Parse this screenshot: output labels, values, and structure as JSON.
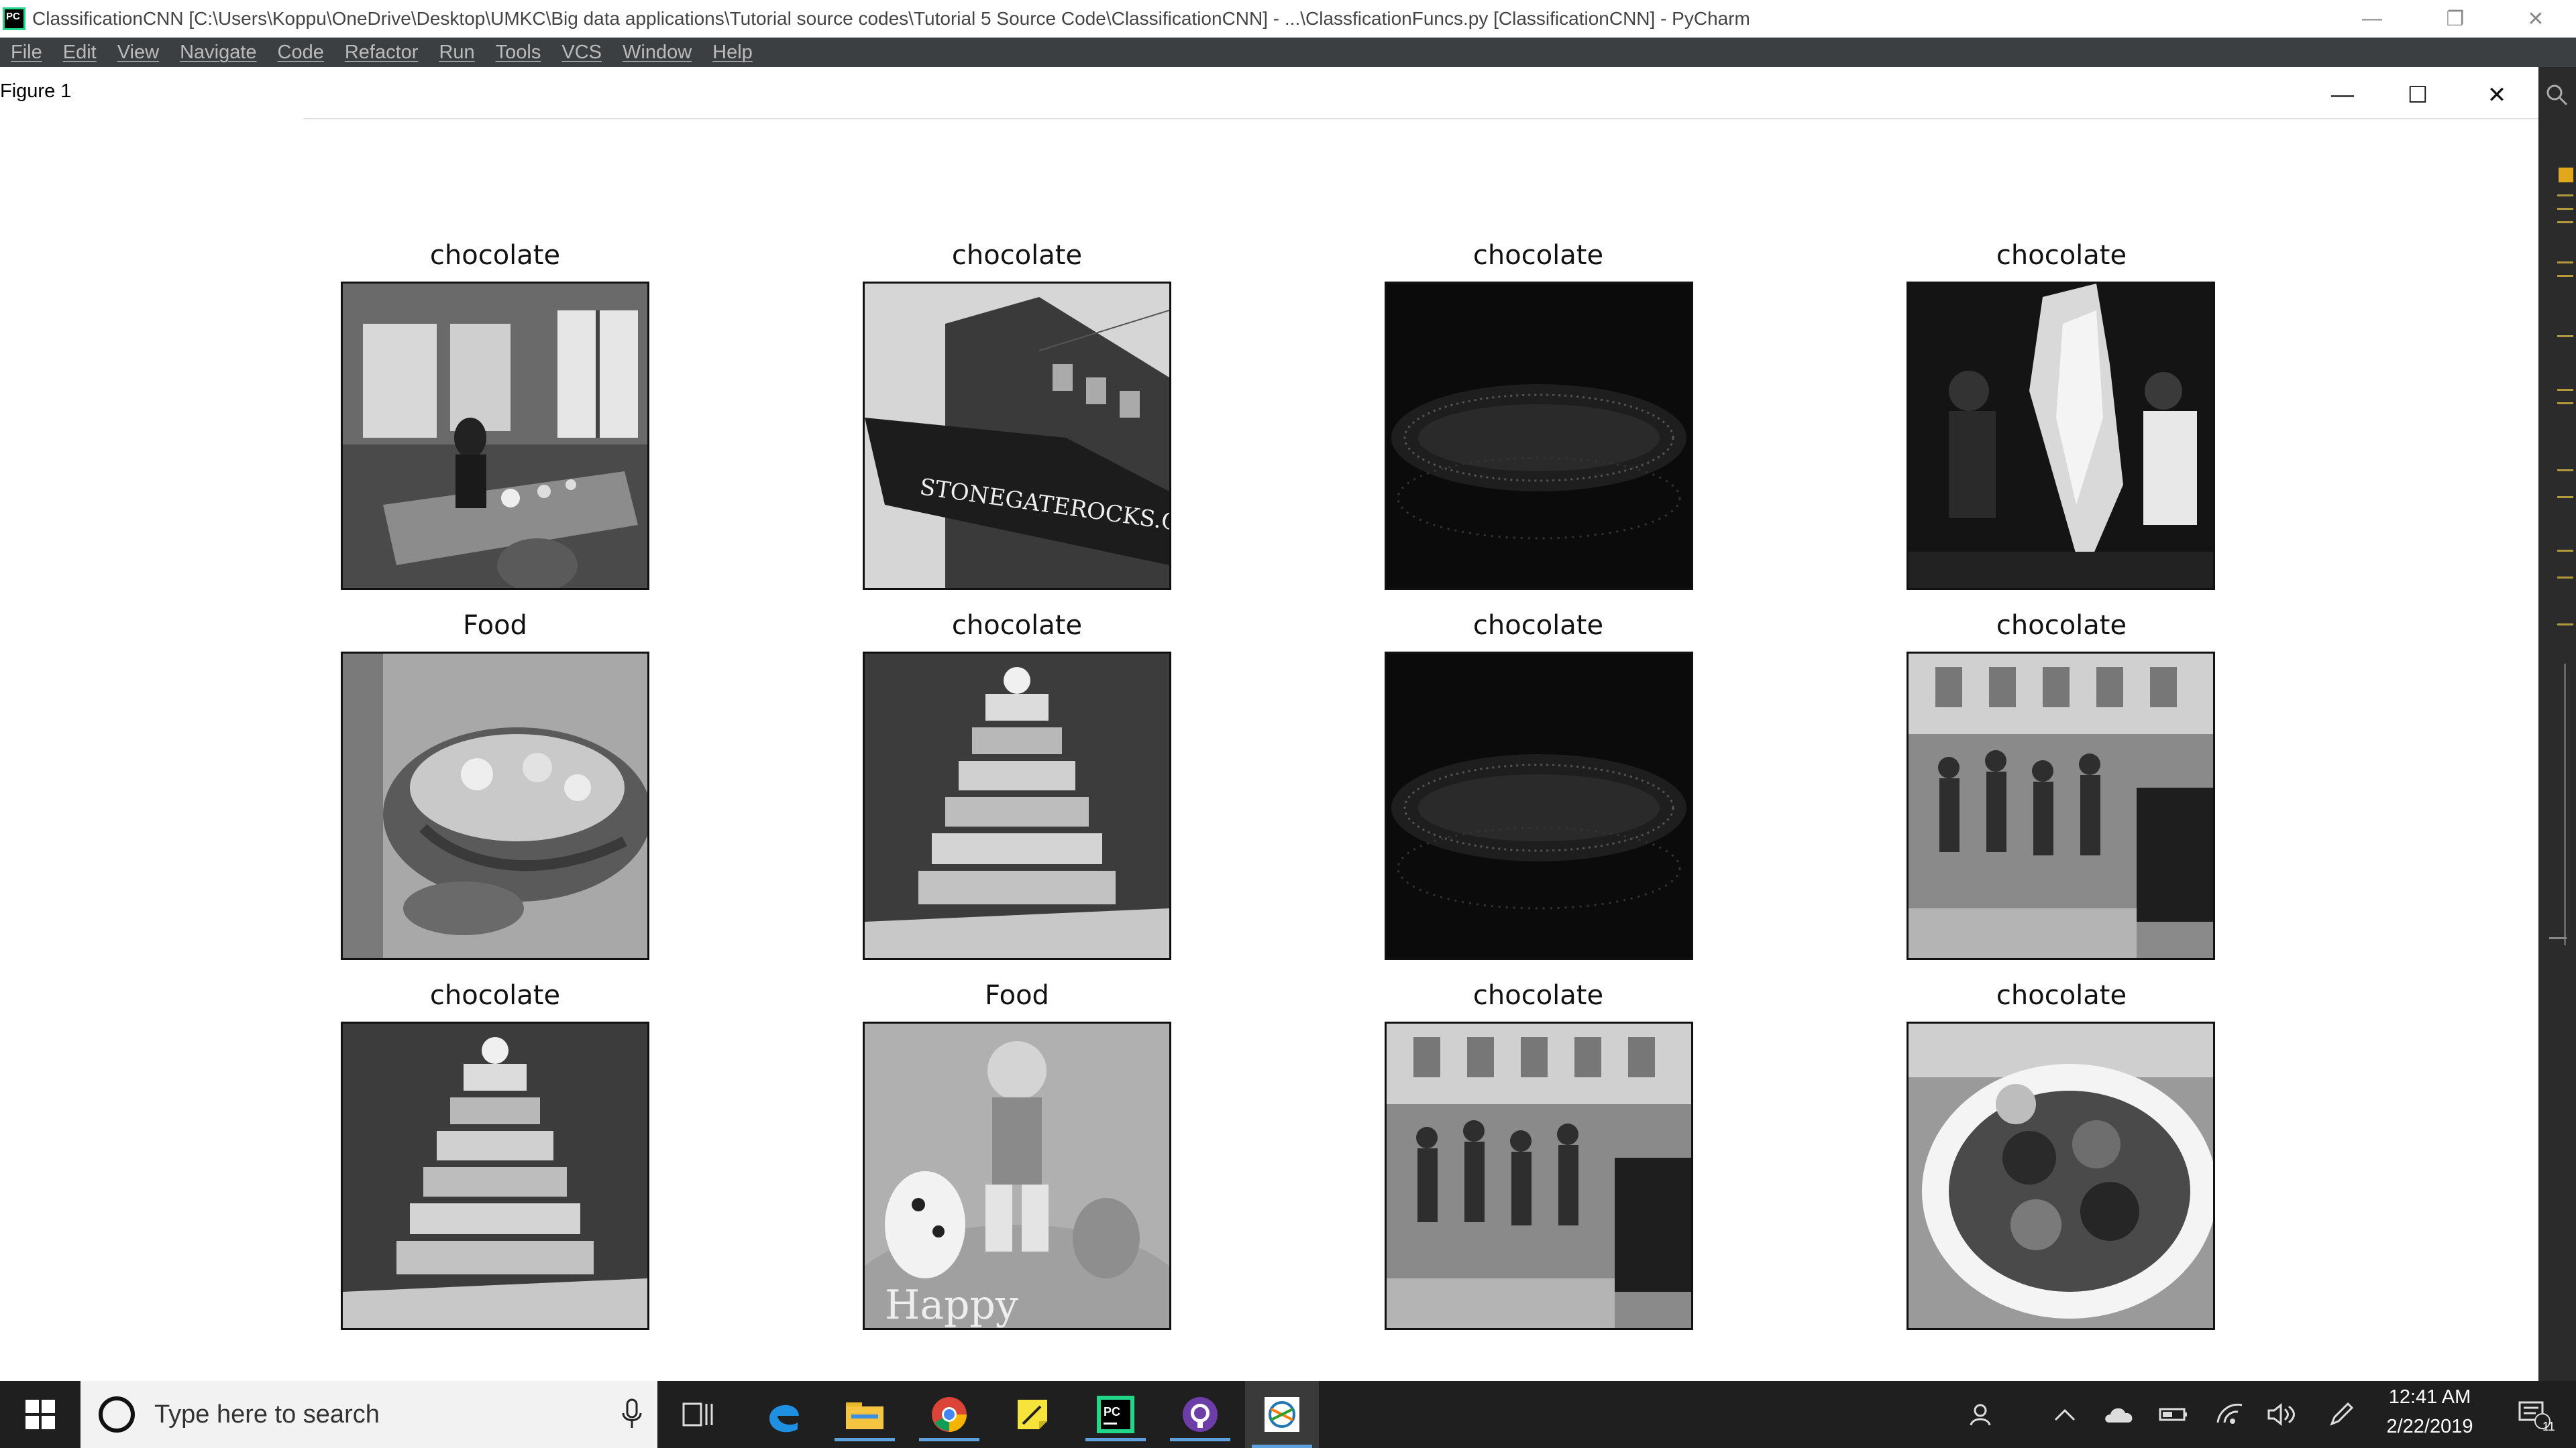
{
  "window": {
    "title": "ClassificationCNN [C:\\Users\\Koppu\\OneDrive\\Desktop\\UMKC\\Big data applications\\Tutorial source codes\\Tutorial 5 Source Code\\ClassificationCNN] - ...\\ClassficationFuncs.py [ClassificationCNN] - PyCharm",
    "app_icon_text": "PC"
  },
  "menu": [
    "File",
    "Edit",
    "View",
    "Navigate",
    "Code",
    "Refactor",
    "Run",
    "Tools",
    "VCS",
    "Window",
    "Help"
  ],
  "figure": {
    "title": "Figure 1",
    "subplots": [
      {
        "title": "chocolate",
        "image": "restaurant dining room with table and person"
      },
      {
        "title": "chocolate",
        "image": "building with Stonegate Rocks awning"
      },
      {
        "title": "chocolate",
        "image": "dark close-up texture"
      },
      {
        "title": "chocolate",
        "image": "street food stall with flames and smoke"
      },
      {
        "title": "Food",
        "image": "basket with food close-up"
      },
      {
        "title": "chocolate",
        "image": "cupcake tower at banquet"
      },
      {
        "title": "chocolate",
        "image": "dark close-up texture"
      },
      {
        "title": "chocolate",
        "image": "crowd in a shop"
      },
      {
        "title": "chocolate",
        "image": "cupcake tower at banquet"
      },
      {
        "title": "Food",
        "image": "fondant cake with figurine and dogs"
      },
      {
        "title": "chocolate",
        "image": "crowd in a shop"
      },
      {
        "title": "chocolate",
        "image": "plate of colorful food"
      }
    ]
  },
  "taskbar": {
    "search_placeholder": "Type here to search",
    "time": "12:41 AM",
    "date": "2/22/2019",
    "notification_count": "11",
    "apps": [
      "task-view",
      "edge",
      "file-explorer",
      "chrome",
      "sticky-notes",
      "pycharm",
      "github",
      "python-figure"
    ]
  },
  "colors": {
    "accent": "#5ea1dd",
    "ide_dark": "#3c3f41",
    "pycharm_green": "#21d789"
  }
}
